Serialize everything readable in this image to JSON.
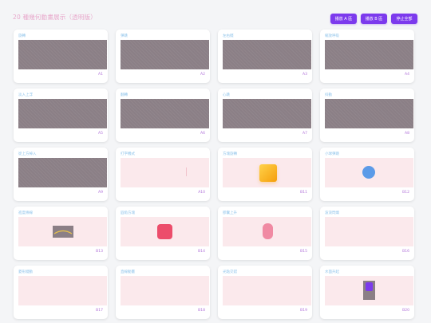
{
  "header": {
    "title": "20 種幾何動畫展示（透明版）",
    "buttons": [
      "播放 A 區",
      "播放 B 區",
      "停止全部"
    ]
  },
  "cards": [
    {
      "label": "旋轉",
      "id": "A1"
    },
    {
      "label": "彈跳",
      "id": "A2"
    },
    {
      "label": "左右擺",
      "id": "A3"
    },
    {
      "label": "縮放呼吸",
      "id": "A4"
    },
    {
      "label": "淡入上浮",
      "id": "A5"
    },
    {
      "label": "翻轉",
      "id": "A6"
    },
    {
      "label": "心跳",
      "id": "A7"
    },
    {
      "label": "抖動",
      "id": "A8"
    },
    {
      "label": "從上方掉入",
      "id": "A9"
    },
    {
      "label": "打字機式",
      "id": "A10"
    },
    {
      "label": "方塊旋轉",
      "id": "B11"
    },
    {
      "label": "小球彈跳",
      "id": "B12"
    },
    {
      "label": "進度條線",
      "id": "B13"
    },
    {
      "label": "圓角方塊",
      "id": "B14"
    },
    {
      "label": "膠囊上升",
      "id": "B15"
    },
    {
      "label": "波浪閃爍",
      "id": "B16"
    },
    {
      "label": "菱形擺動",
      "id": "B17"
    },
    {
      "label": "直線動畫",
      "id": "B18"
    },
    {
      "label": "光點交錯",
      "id": "B19"
    },
    {
      "label": "水面升起",
      "id": "B20"
    }
  ],
  "colors": {
    "accent": "#7c3aed",
    "stage_light": "#fbe9ec",
    "stage_dark": "#8b7f86",
    "label": "#8ec3ea",
    "id": "#b071d9"
  }
}
